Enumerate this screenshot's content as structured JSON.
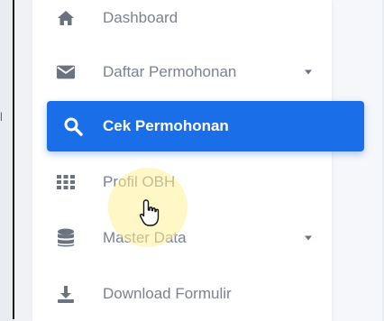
{
  "sidebar": {
    "items": [
      {
        "label": "Dashboard",
        "icon": "home-icon",
        "has_caret": false,
        "active": false
      },
      {
        "label": "Daftar Permohonan",
        "icon": "envelope-icon",
        "has_caret": true,
        "active": false
      },
      {
        "label": "Cek Permohonan",
        "icon": "search-icon",
        "has_caret": false,
        "active": true
      },
      {
        "label": "Profil OBH",
        "icon": "grid-icon",
        "has_caret": false,
        "active": false
      },
      {
        "label": "Master Data",
        "icon": "database-icon",
        "has_caret": true,
        "active": false
      },
      {
        "label": "Download Formulir",
        "icon": "download-icon",
        "has_caret": false,
        "active": false
      }
    ]
  },
  "colors": {
    "accent": "#1a6fe8",
    "text_muted": "#7b8190",
    "background": "#ffffff"
  }
}
